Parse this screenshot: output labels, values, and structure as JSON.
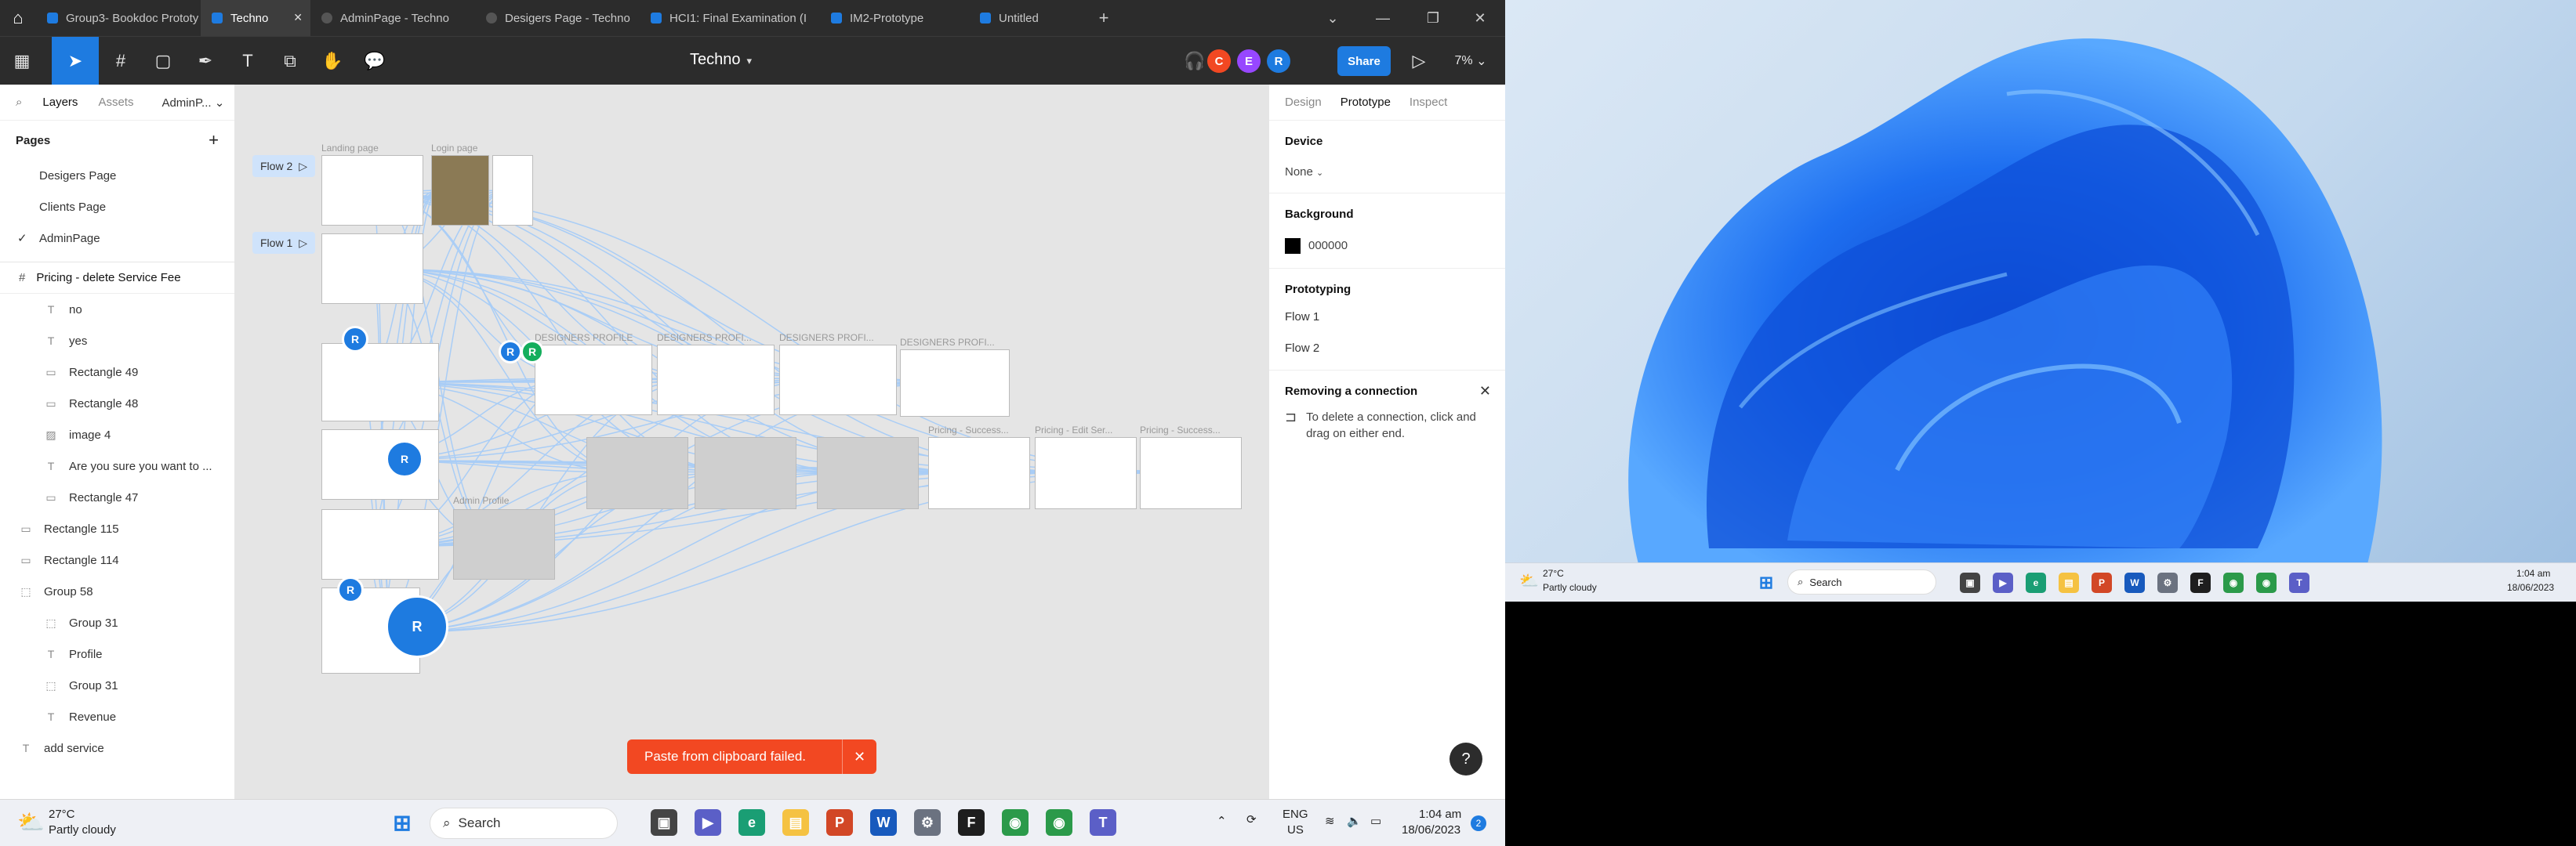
{
  "browser_tabs": [
    {
      "label": "Group3- Bookdoc Prototy",
      "active": false
    },
    {
      "label": "Techno",
      "active": true
    },
    {
      "label": "AdminPage - Techno",
      "active": false
    },
    {
      "label": "Desigers Page - Techno",
      "active": false
    },
    {
      "label": "HCI1: Final Examination (I",
      "active": false
    },
    {
      "label": "IM2-Prototype",
      "active": false
    },
    {
      "label": "Untitled",
      "active": false
    }
  ],
  "toolbar": {
    "doc_title": "Techno",
    "avatars": [
      "C",
      "E",
      "R"
    ],
    "share_label": "Share",
    "zoom": "7%"
  },
  "left_panel": {
    "tabs": [
      "Layers",
      "Assets",
      "AdminP..."
    ],
    "pages_header": "Pages",
    "pages": [
      "Desigers Page",
      "Clients Page",
      "AdminPage"
    ],
    "current_page": "AdminPage",
    "frame_name": "Pricing - delete Service Fee",
    "layers": [
      {
        "name": "no",
        "type": "text",
        "indent": 2
      },
      {
        "name": "yes",
        "type": "text",
        "indent": 2
      },
      {
        "name": "Rectangle 49",
        "type": "rect",
        "indent": 2
      },
      {
        "name": "Rectangle 48",
        "type": "rect",
        "indent": 2
      },
      {
        "name": "image 4",
        "type": "image",
        "indent": 2
      },
      {
        "name": "Are you sure you want to ...",
        "type": "text",
        "indent": 2
      },
      {
        "name": "Rectangle 47",
        "type": "rect",
        "indent": 2
      },
      {
        "name": "Rectangle 115",
        "type": "rect",
        "indent": 1
      },
      {
        "name": "Rectangle 114",
        "type": "rect",
        "indent": 1
      },
      {
        "name": "Group 58",
        "type": "group",
        "indent": 1
      },
      {
        "name": "Group 31",
        "type": "group",
        "indent": 2
      },
      {
        "name": "Profile",
        "type": "text",
        "indent": 2
      },
      {
        "name": "Group 31",
        "type": "group",
        "indent": 2
      },
      {
        "name": "Revenue",
        "type": "text",
        "indent": 2
      },
      {
        "name": "add service",
        "type": "text",
        "indent": 1
      }
    ]
  },
  "canvas": {
    "flows": [
      "Flow 2",
      "Flow 1"
    ],
    "frame_labels": [
      "Landing page",
      "Login page",
      "DESIGNERS PROFILE",
      "DESIGNERS PROFI...",
      "DESIGNERS PROFI...",
      "DESIGNERS PROFI...",
      "Pricing - Success...",
      "Pricing - Edit Ser...",
      "Pricing - Success...",
      "Admin Profile"
    ],
    "toast_message": "Paste from clipboard failed.",
    "help_label": "?"
  },
  "right_panel": {
    "tabs": [
      "Design",
      "Prototype",
      "Inspect"
    ],
    "active_tab": "Prototype",
    "device_label": "Device",
    "device_value": "None",
    "background_label": "Background",
    "background_value": "000000",
    "prototyping_label": "Prototyping",
    "flows": [
      "Flow 1",
      "Flow 2"
    ],
    "hint_title": "Removing a connection",
    "hint_text": "To delete a connection, click and drag on either end."
  },
  "taskbar_left": {
    "weather_temp": "27°C",
    "weather_desc": "Partly cloudy",
    "search_placeholder": "Search",
    "lang": "ENG",
    "region": "US",
    "time": "1:04 am",
    "date": "18/06/2023",
    "notif_count": "2"
  },
  "taskbar_right": {
    "weather_temp": "27°C",
    "weather_desc": "Partly cloudy",
    "search_placeholder": "Search",
    "time": "1:04 am",
    "date": "18/06/2023"
  },
  "colors": {
    "figma_blue": "#1e7be0",
    "toast_red": "#f24822",
    "dark_chrome": "#2c2c2c"
  }
}
